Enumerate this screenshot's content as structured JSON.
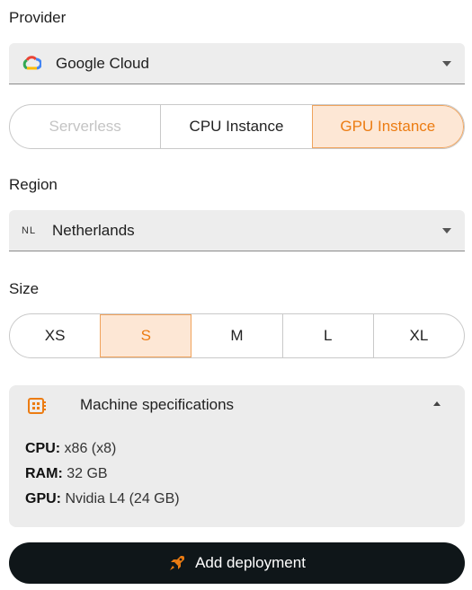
{
  "provider": {
    "label": "Provider",
    "value": "Google Cloud",
    "icon": "google-cloud-icon"
  },
  "instance_types": {
    "options": [
      "Serverless",
      "CPU Instance",
      "GPU Instance"
    ],
    "selected": "GPU Instance",
    "disabled": [
      "Serverless"
    ]
  },
  "region": {
    "label": "Region",
    "code": "NL",
    "value": "Netherlands"
  },
  "size": {
    "label": "Size",
    "options": [
      "XS",
      "S",
      "M",
      "L",
      "XL"
    ],
    "selected": "S"
  },
  "machine_specs": {
    "title": "Machine specifications",
    "icon": "cpu-chip-icon",
    "cpu_label": "CPU:",
    "cpu_value": " x86 (x8)",
    "ram_label": "RAM:",
    "ram_value": " 32 GB",
    "gpu_label": "GPU:",
    "gpu_value": " Nvidia L4 (24 GB)"
  },
  "deploy_button": {
    "label": "Add deployment",
    "icon": "rocket-icon"
  },
  "colors": {
    "accent": "#ec7c12",
    "accent_bg": "#fde7d5",
    "button_bg": "#0f1619"
  }
}
